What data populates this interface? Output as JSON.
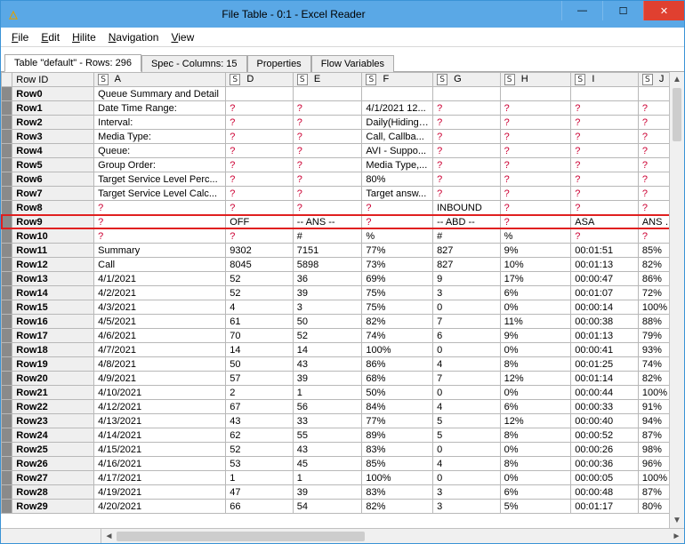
{
  "window": {
    "title": "File Table - 0:1 - Excel Reader",
    "icon_glyph": "△"
  },
  "menubar": [
    "File",
    "Edit",
    "Hilite",
    "Navigation",
    "View"
  ],
  "tabs": [
    {
      "label": "Table \"default\" - Rows: 296",
      "active": true
    },
    {
      "label": "Spec - Columns: 15",
      "active": false
    },
    {
      "label": "Properties",
      "active": false
    },
    {
      "label": "Flow Variables",
      "active": false
    }
  ],
  "rowid_header": "Row ID",
  "col_type_glyph": "S",
  "columns": [
    "A",
    "D",
    "E",
    "F",
    "G",
    "H",
    "I",
    "J"
  ],
  "rows": [
    {
      "id": "Row0",
      "cells": [
        "Queue Summary and Detail",
        "",
        "",
        "",
        "",
        "",
        "",
        ""
      ]
    },
    {
      "id": "Row1",
      "cells": [
        "Date Time Range:",
        "?",
        "?",
        "4/1/2021 12...",
        "?",
        "?",
        "?",
        "?"
      ]
    },
    {
      "id": "Row2",
      "cells": [
        "Interval:",
        "?",
        "?",
        "Daily(Hiding ...",
        "?",
        "?",
        "?",
        "?"
      ]
    },
    {
      "id": "Row3",
      "cells": [
        "Media Type:",
        "?",
        "?",
        "   Call, Callba...",
        "?",
        "?",
        "?",
        "?"
      ]
    },
    {
      "id": "Row4",
      "cells": [
        "Queue:",
        "?",
        "?",
        "AVI - Suppo...",
        "?",
        "?",
        "?",
        "?"
      ]
    },
    {
      "id": "Row5",
      "cells": [
        "Group Order:",
        "?",
        "?",
        "Media Type,...",
        "?",
        "?",
        "?",
        "?"
      ]
    },
    {
      "id": "Row6",
      "cells": [
        "Target Service Level Perc...",
        "?",
        "?",
        "80%",
        "?",
        "?",
        "?",
        "?"
      ]
    },
    {
      "id": "Row7",
      "cells": [
        "Target Service Level Calc...",
        "?",
        "?",
        "Target answ...",
        "?",
        "?",
        "?",
        "?"
      ]
    },
    {
      "id": "Row8",
      "cells": [
        "?",
        "?",
        "?",
        "?",
        "INBOUND",
        "?",
        "?",
        "?"
      ]
    },
    {
      "id": "Row9",
      "cells": [
        "?",
        "OFF",
        "-- ANS --",
        "?",
        "-- ABD --",
        "?",
        "ASA",
        "ANS SVC"
      ]
    },
    {
      "id": "Row10",
      "cells": [
        "?",
        "?",
        "#",
        "%",
        "#",
        "%",
        "?",
        "?"
      ]
    },
    {
      "id": "Row11",
      "cells": [
        "Summary",
        "9302",
        "7151",
        "77%",
        "827",
        "9%",
        "00:01:51",
        "85%"
      ]
    },
    {
      "id": "Row12",
      "cells": [
        "Call",
        "8045",
        "5898",
        "73%",
        "827",
        "10%",
        "00:01:13",
        "82%"
      ]
    },
    {
      "id": "Row13",
      "cells": [
        "4/1/2021",
        "52",
        "36",
        "69%",
        "9",
        "17%",
        "00:00:47",
        "86%"
      ]
    },
    {
      "id": "Row14",
      "cells": [
        "4/2/2021",
        "52",
        "39",
        "75%",
        "3",
        "6%",
        "00:01:07",
        "72%"
      ]
    },
    {
      "id": "Row15",
      "cells": [
        "4/3/2021",
        "4",
        "3",
        "75%",
        "0",
        "0%",
        "00:00:14",
        "100%"
      ]
    },
    {
      "id": "Row16",
      "cells": [
        "4/5/2021",
        "61",
        "50",
        "82%",
        "7",
        "11%",
        "00:00:38",
        "88%"
      ]
    },
    {
      "id": "Row17",
      "cells": [
        "4/6/2021",
        "70",
        "52",
        "74%",
        "6",
        "9%",
        "00:01:13",
        "79%"
      ]
    },
    {
      "id": "Row18",
      "cells": [
        "4/7/2021",
        "14",
        "14",
        "100%",
        "0",
        "0%",
        "00:00:41",
        "93%"
      ]
    },
    {
      "id": "Row19",
      "cells": [
        "4/8/2021",
        "50",
        "43",
        "86%",
        "4",
        "8%",
        "00:01:25",
        "74%"
      ]
    },
    {
      "id": "Row20",
      "cells": [
        "4/9/2021",
        "57",
        "39",
        "68%",
        "7",
        "12%",
        "00:01:14",
        "82%"
      ]
    },
    {
      "id": "Row21",
      "cells": [
        "4/10/2021",
        "2",
        "1",
        "50%",
        "0",
        "0%",
        "00:00:44",
        "100%"
      ]
    },
    {
      "id": "Row22",
      "cells": [
        "4/12/2021",
        "67",
        "56",
        "84%",
        "4",
        "6%",
        "00:00:33",
        "91%"
      ]
    },
    {
      "id": "Row23",
      "cells": [
        "4/13/2021",
        "43",
        "33",
        "77%",
        "5",
        "12%",
        "00:00:40",
        "94%"
      ]
    },
    {
      "id": "Row24",
      "cells": [
        "4/14/2021",
        "62",
        "55",
        "89%",
        "5",
        "8%",
        "00:00:52",
        "87%"
      ]
    },
    {
      "id": "Row25",
      "cells": [
        "4/15/2021",
        "52",
        "43",
        "83%",
        "0",
        "0%",
        "00:00:26",
        "98%"
      ]
    },
    {
      "id": "Row26",
      "cells": [
        "4/16/2021",
        "53",
        "45",
        "85%",
        "4",
        "8%",
        "00:00:36",
        "96%"
      ]
    },
    {
      "id": "Row27",
      "cells": [
        "4/17/2021",
        "1",
        "1",
        "100%",
        "0",
        "0%",
        "00:00:05",
        "100%"
      ]
    },
    {
      "id": "Row28",
      "cells": [
        "4/19/2021",
        "47",
        "39",
        "83%",
        "3",
        "6%",
        "00:00:48",
        "87%"
      ]
    },
    {
      "id": "Row29",
      "cells": [
        "4/20/2021",
        "66",
        "54",
        "82%",
        "3",
        "5%",
        "00:01:17",
        "80%"
      ]
    }
  ],
  "highlight_row_index": 9
}
